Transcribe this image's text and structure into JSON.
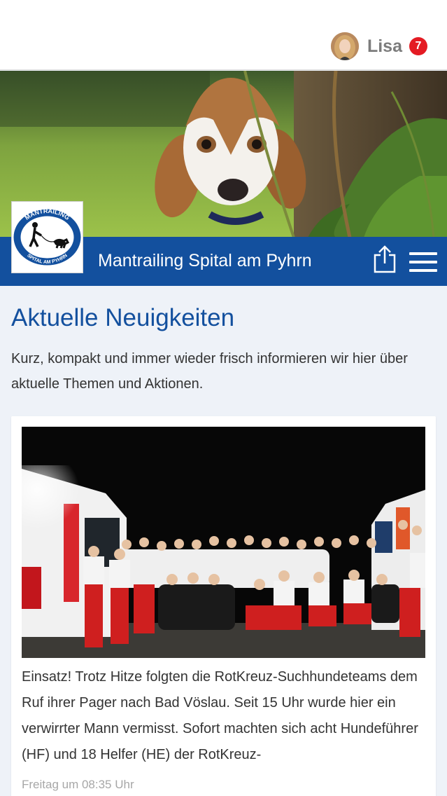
{
  "header": {
    "user_name": "Lisa",
    "notification_count": "7"
  },
  "brand": {
    "title": "Mantrailing Spital am Pyhrn",
    "logo_text_top": "MANTRAILING",
    "logo_text_bottom": "SPITAL AM PYHRN"
  },
  "page": {
    "headline": "Aktuelle Neuigkeiten",
    "intro": "Kurz, kompakt und immer wieder frisch informieren wir hier über aktuelle Themen und Aktionen."
  },
  "post": {
    "text": "Einsatz! Trotz Hitze folgten die RotKreuz-Suchhundeteams dem Ruf ihrer Pager nach Bad Vöslau. Seit 15 Uhr wurde hier ein verwirrter Mann vermisst. Sofort machten sich acht Hundeführer (HF) und 18 Helfer (HE) der RotKreuz-",
    "time": "Freitag um 08:35 Uhr"
  },
  "colors": {
    "brand_blue": "#13509e",
    "badge_red": "#e41b23"
  },
  "icons": {
    "share": "share-icon",
    "menu": "hamburger-menu-icon"
  }
}
